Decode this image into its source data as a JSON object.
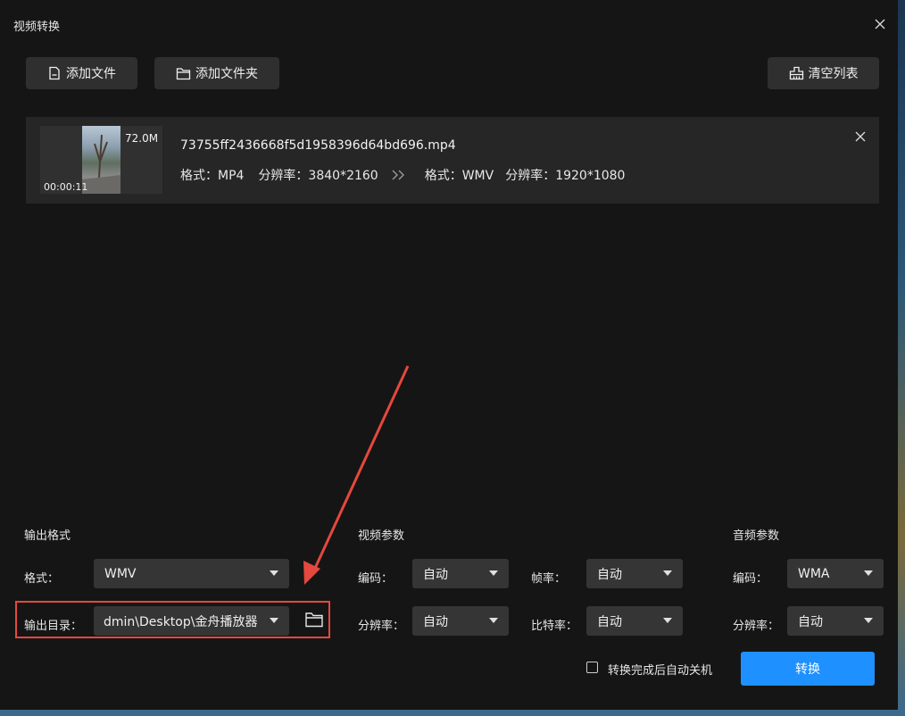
{
  "window": {
    "title": "视频转换"
  },
  "toolbar": {
    "add_file_label": "添加文件",
    "add_folder_label": "添加文件夹",
    "clear_list_label": "清空列表"
  },
  "file_list": [
    {
      "size": "72.0M",
      "duration": "00:00:11",
      "name": "73755ff2436668f5d1958396d64bd696.mp4",
      "source_format_label": "格式：MP4",
      "source_resolution_label": "分辨率：3840*2160",
      "target_format_label": "格式：WMV",
      "target_resolution_label": "分辨率：1920*1080"
    }
  ],
  "output": {
    "section_title": "输出格式",
    "format_label": "格式：",
    "format_value": "WMV",
    "dir_label": "输出目录：",
    "dir_value": "dmin\\Desktop\\金舟播放器"
  },
  "video_params": {
    "section_title": "视频参数",
    "codec_label": "编码：",
    "codec_value": "自动",
    "fps_label": "帧率：",
    "fps_value": "自动",
    "resolution_label": "分辨率：",
    "resolution_value": "自动",
    "bitrate_label": "比特率：",
    "bitrate_value": "自动"
  },
  "audio_params": {
    "section_title": "音频参数",
    "codec_label": "编码：",
    "codec_value": "WMA",
    "resolution_label": "分辨率：",
    "resolution_value": "自动"
  },
  "footer": {
    "auto_shutdown_label": "转换完成后自动关机",
    "convert_label": "转换"
  },
  "colors": {
    "accent": "#1e90ff",
    "annotation": "#e5483e",
    "panel": "#151515"
  }
}
